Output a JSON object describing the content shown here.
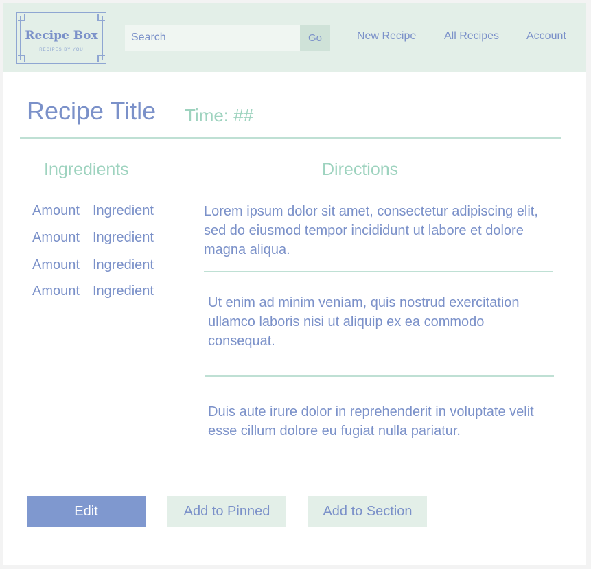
{
  "header": {
    "logo": {
      "title": "Recipe Box",
      "subtitle": "RECIPES BY YOU"
    },
    "search": {
      "placeholder": "Search",
      "go_label": "Go"
    },
    "nav": {
      "new_recipe": "New Recipe",
      "all_recipes": "All Recipes",
      "account": "Account"
    }
  },
  "recipe": {
    "title": "Recipe Title",
    "time": "Time: ##",
    "ingredients_heading": "Ingredients",
    "directions_heading": "Directions",
    "ingredients": [
      {
        "amount": "Amount",
        "name": "Ingredient"
      },
      {
        "amount": "Amount",
        "name": "Ingredient"
      },
      {
        "amount": "Amount",
        "name": "Ingredient"
      },
      {
        "amount": "Amount",
        "name": "Ingredient"
      }
    ],
    "directions": [
      "Lorem ipsum dolor sit amet, consectetur adipiscing elit, sed do eiusmod tempor incididunt ut labore et dolore magna aliqua.",
      "Ut enim ad minim veniam, quis nostrud exercitation ullamco laboris nisi ut aliquip ex ea commodo consequat.",
      "Duis aute irure dolor in reprehenderit in voluptate velit esse cillum dolore eu fugiat nulla pariatur."
    ]
  },
  "actions": {
    "edit": "Edit",
    "add_to_pinned": "Add to Pinned",
    "add_to_section": "Add to Section"
  },
  "colors": {
    "accent": "#7b91c9",
    "mint": "#9ed3bf",
    "header_bg": "#e3efe8",
    "button_primary": "#7f98cf"
  }
}
